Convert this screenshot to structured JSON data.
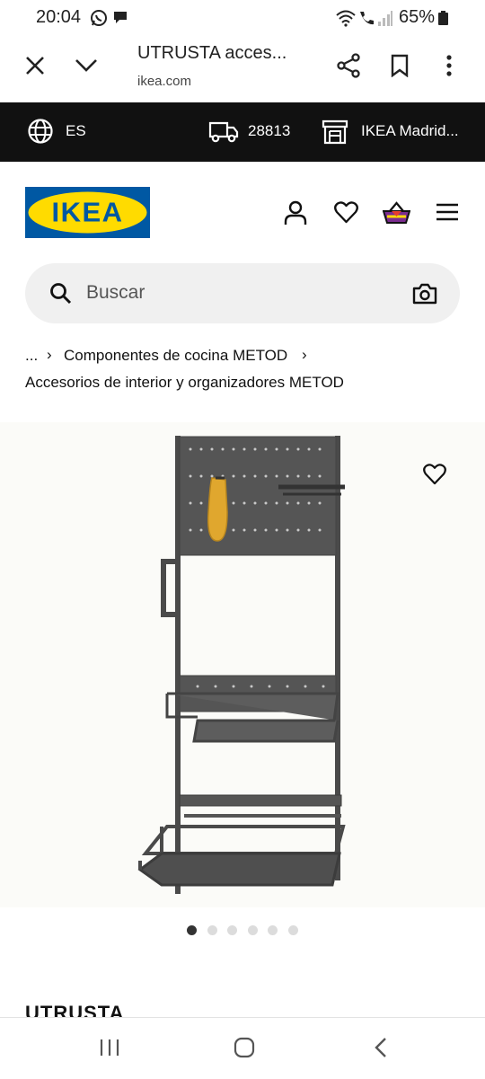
{
  "status_bar": {
    "time": "20:04",
    "battery": "65%",
    "icons": [
      "whatsapp-icon",
      "chat-bubble-icon",
      "wifi-icon",
      "wifi-calling-icon",
      "signal-icon",
      "battery-icon"
    ]
  },
  "browser": {
    "title": "UTRUSTA acces...",
    "domain": "ikea.com",
    "icons": [
      "close-icon",
      "chevron-down-icon",
      "share-icon",
      "bookmark-icon",
      "more-vert-icon"
    ]
  },
  "location_bar": {
    "language": "ES",
    "postal_code": "28813",
    "store": "IKEA Madrid..."
  },
  "header": {
    "logo_text": "IKEA",
    "icons": [
      "profile-icon",
      "heart-icon",
      "basket-icon",
      "hamburger-icon"
    ]
  },
  "search": {
    "placeholder": "Buscar"
  },
  "breadcrumb": {
    "ellipsis": "...",
    "separator": "›",
    "item1": "Componentes de cocina METOD",
    "item2": "Accesorios de interior y organizadores METOD"
  },
  "product": {
    "carousel_count": 6,
    "carousel_active_index": 0,
    "name_partial": "UTRUSTA"
  },
  "colors": {
    "ikea_blue": "#0058a3",
    "ikea_yellow": "#ffdb00",
    "location_bar": "#111111",
    "search_bg": "#f0f0f0"
  }
}
